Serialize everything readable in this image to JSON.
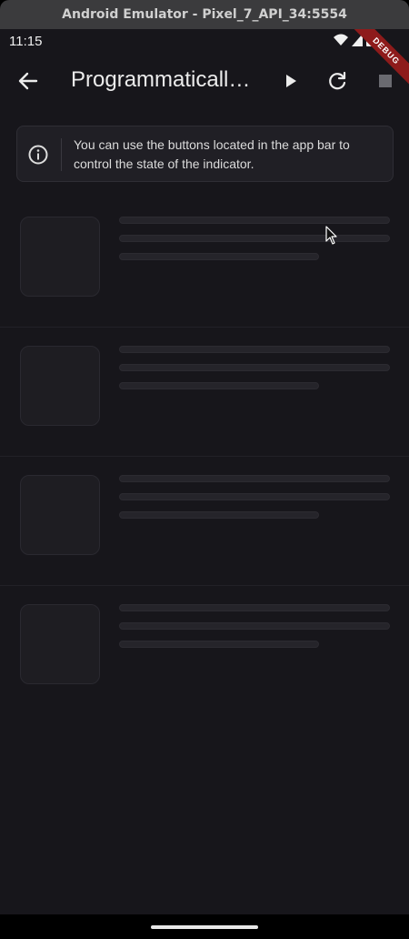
{
  "window": {
    "title": "Android Emulator - Pixel_7_API_34:5554"
  },
  "status_bar": {
    "time": "11:15",
    "icons": [
      "wifi-icon",
      "signal-icon",
      "battery-icon"
    ]
  },
  "debug_banner": {
    "label": "DEBUG"
  },
  "app_bar": {
    "title": "Programmaticall…",
    "actions": [
      "back-arrow-icon",
      "play-icon",
      "refresh-icon",
      "stop-icon"
    ]
  },
  "info_card": {
    "text": "You can use the buttons located in the app bar to control the state of the indicator."
  },
  "skeleton_list": {
    "item_count": 4
  },
  "colors": {
    "background": "#17161b",
    "card": "#201f25",
    "text": "#ececec",
    "skeleton": "#25242a",
    "debug_ribbon": "#8e1b1b"
  }
}
